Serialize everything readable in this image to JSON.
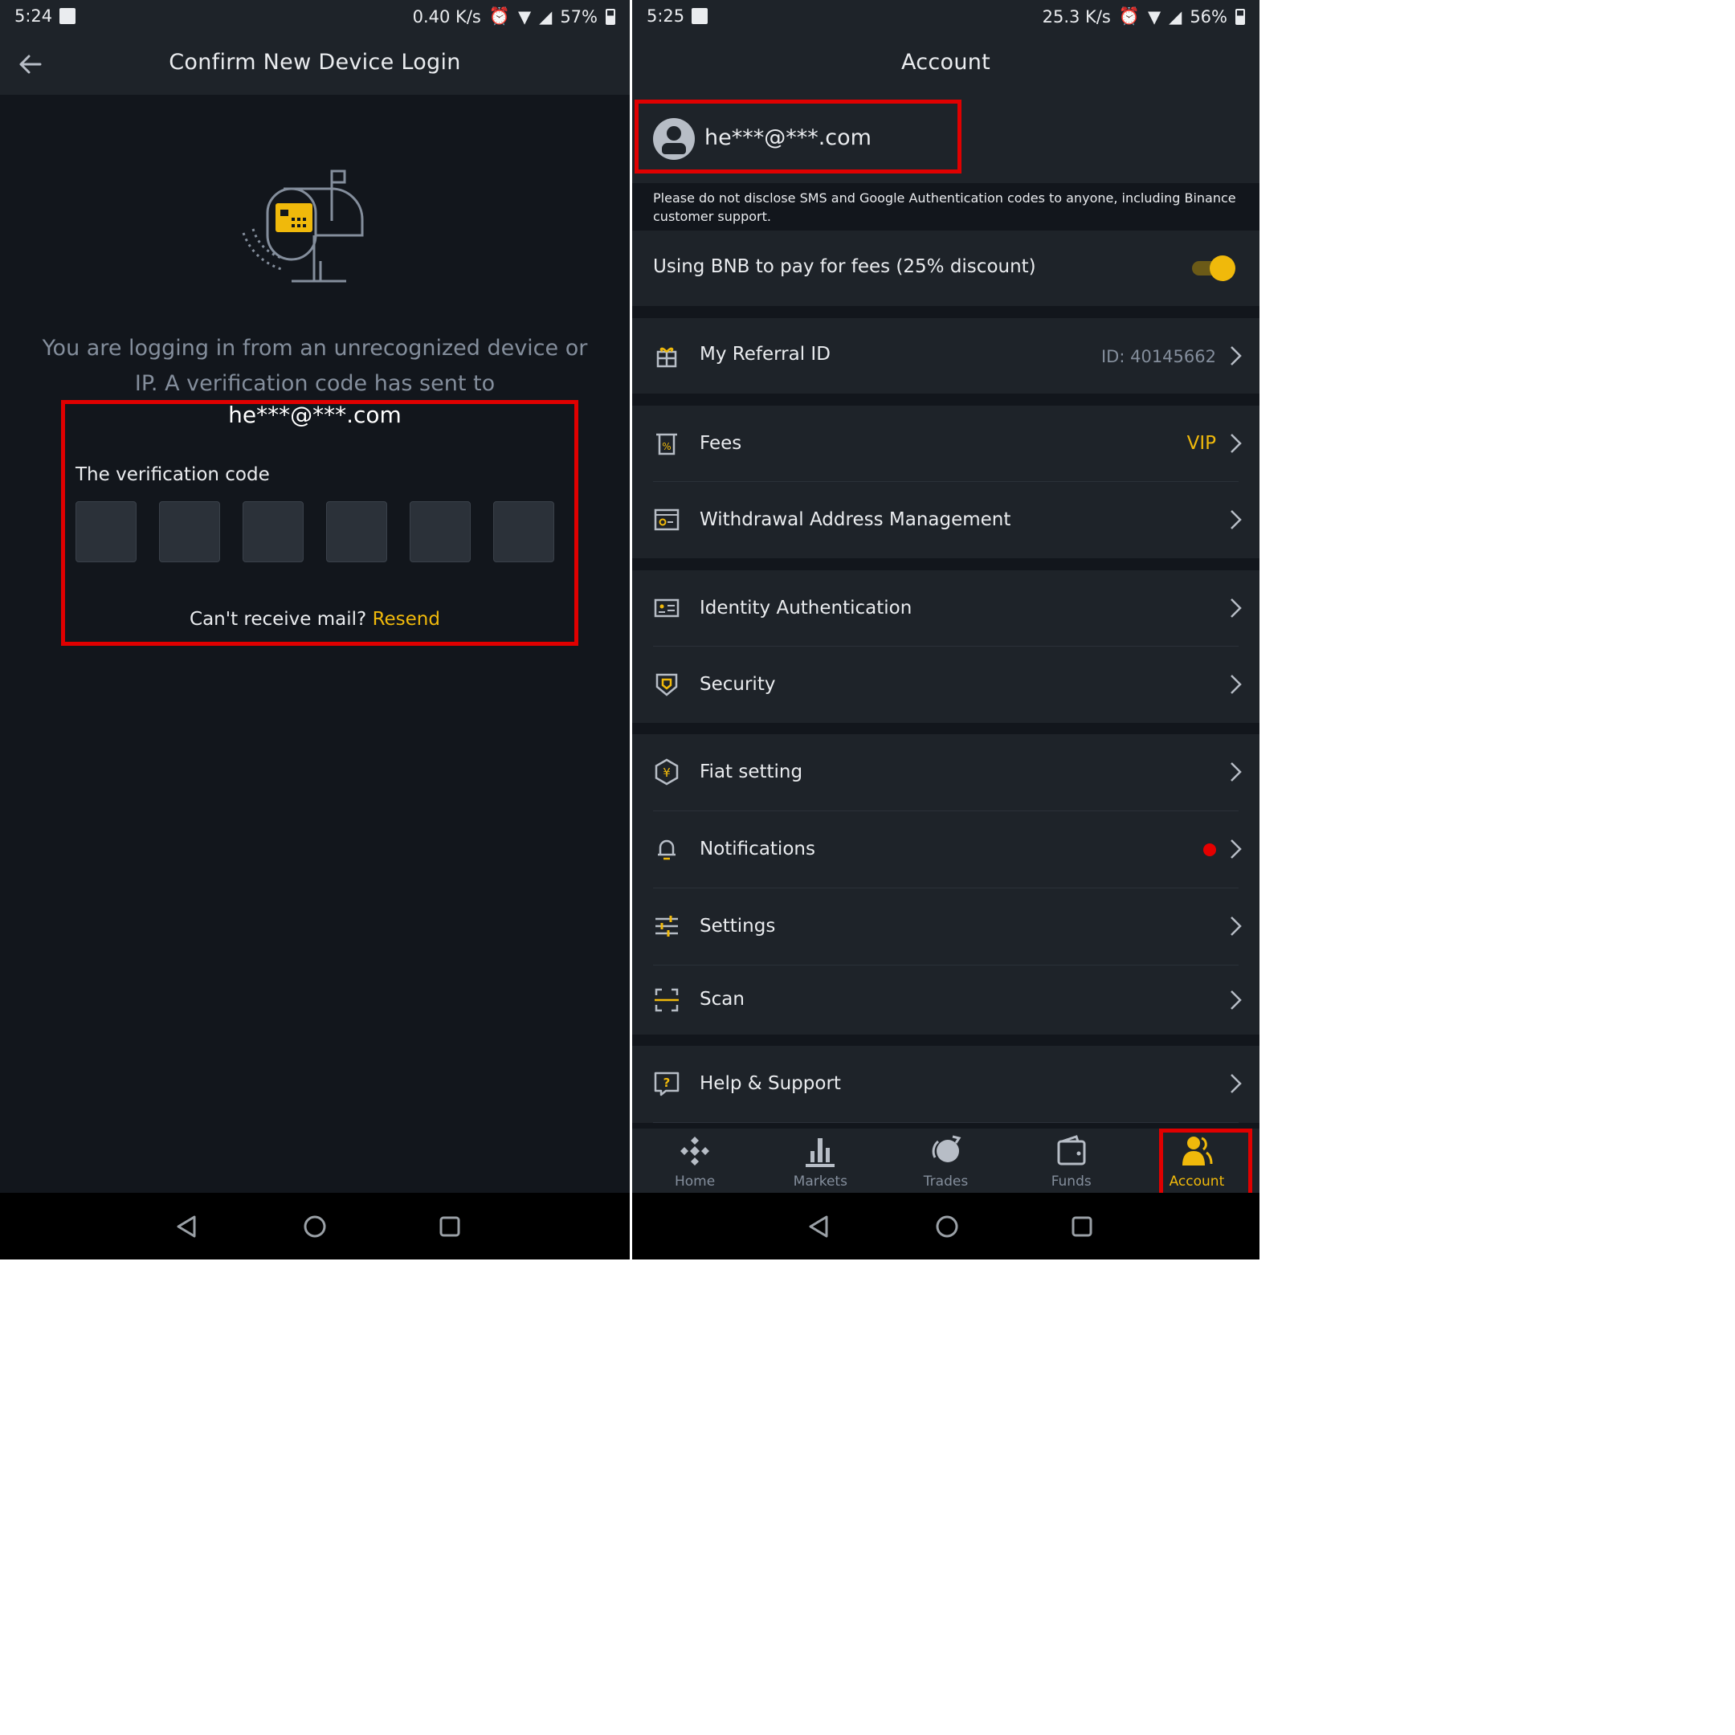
{
  "left": {
    "status": {
      "time": "5:24",
      "speed": "0.40 K/s",
      "battery": "57%"
    },
    "header_title": "Confirm New Device Login",
    "message": "You are logging in from an unrecognized device or IP. A verification code has sent to",
    "email": "he***@***.com",
    "verification_label": "The verification code",
    "code_boxes": [
      "",
      "",
      "",
      "",
      "",
      ""
    ],
    "resend_prompt": "Can't receive mail?",
    "resend_link": "Resend",
    "icons": {
      "back": "back-arrow-icon",
      "illustration": "mailbox-icon"
    }
  },
  "right": {
    "status": {
      "time": "5:25",
      "speed": "25.3 K/s",
      "battery": "56%"
    },
    "header_title": "Account",
    "profile_email": "he***@***.com",
    "warning": "Please do not disclose SMS and Google Authentication codes to anyone, including Binance customer support.",
    "bnb_fee_label": "Using BNB to pay for fees (25% discount)",
    "bnb_fee_enabled": true,
    "menu": {
      "referral": {
        "label": "My Referral ID",
        "value": "ID: 40145662",
        "icon": "gift-icon"
      },
      "fees": {
        "label": "Fees",
        "value": "VIP",
        "icon": "fee-ticket-icon"
      },
      "withdrawal": {
        "label": "Withdrawal Address Management",
        "icon": "address-book-icon"
      },
      "identity": {
        "label": "Identity Authentication",
        "icon": "id-card-icon"
      },
      "security": {
        "label": "Security",
        "icon": "shield-icon"
      },
      "fiat": {
        "label": "Fiat setting",
        "icon": "yen-hexagon-icon"
      },
      "notifications": {
        "label": "Notifications",
        "icon": "bell-icon"
      },
      "settings": {
        "label": "Settings",
        "icon": "sliders-icon"
      },
      "scan": {
        "label": "Scan",
        "icon": "scan-icon"
      },
      "help": {
        "label": "Help & Support",
        "icon": "help-icon"
      }
    },
    "tabs": [
      {
        "label": "Home",
        "icon": "home-icon"
      },
      {
        "label": "Markets",
        "icon": "markets-icon"
      },
      {
        "label": "Trades",
        "icon": "trades-icon"
      },
      {
        "label": "Funds",
        "icon": "wallet-icon"
      },
      {
        "label": "Account",
        "icon": "account-icon",
        "active": true
      }
    ]
  },
  "colors": {
    "accent": "#f0b90b",
    "highlight": "#e00000",
    "background": "#12161c",
    "surface": "#1e2329",
    "muted": "#848e9c"
  }
}
